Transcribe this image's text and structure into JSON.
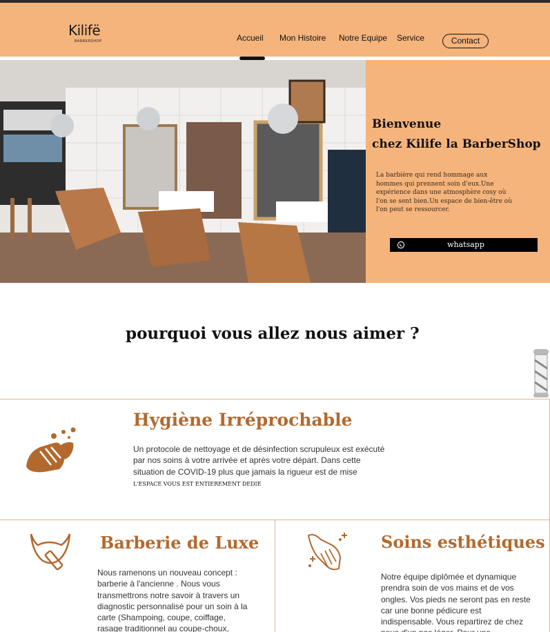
{
  "header": {
    "logo_text": "Kilifë",
    "logo_subtitle": "BARBERSHOP",
    "nav": {
      "home": "Accueil",
      "story": "Mon Histoire",
      "team": "Notre Equipe",
      "service": "Service",
      "contact": "Contact"
    }
  },
  "hero": {
    "title_line1": "Bienvenue",
    "title_line2": "chez Kilife la BarberShop",
    "description": "La barbière qui rend hommage aux hommes qui prennent soin d'eux.Une expérience dans une atmosphère cosy où l'on se sent bien.Un espace de bien-être où l'on peut se ressourcer.",
    "whatsapp_label": "whatsapp",
    "image_desc": "barbershop-interior-photo"
  },
  "why": {
    "title": "pourquoi vous allez nous aimer ?"
  },
  "features": {
    "hygiene": {
      "title": "Hygiène Irréprochable",
      "text": "Un protocole de nettoyage et de désinfection scrupuleux est exécuté par nos soins à votre arrivée et après votre départ. Dans cette situation de COVID-19 plus que jamais la rigueur est de mise",
      "small": "L'ESPACE VOUS EST ENTIEREMENT DEDIE"
    },
    "luxury": {
      "title": "Barberie de Luxe",
      "text": "Nous ramenons un nouveau concept : barberie à l'ancienne . Nous vous transmettrons notre savoir à travers un diagnostic personnalisé pour un soin à la carte (Shampoing, coupe, coiffage, rasage traditionnel au coupe-choux,"
    },
    "care": {
      "title": "Soins esthétiques",
      "text": "Notre équipe diplômée et dynamique prendra soin de vos mains et de vos ongles. Vos pieds ne seront pas en reste car une bonne pédicure est indispensable. Vous repartirez de chez nous d'un pas léger. Pour une"
    }
  },
  "colors": {
    "accent": "#f5b47c",
    "brand_brown": "#b3692e",
    "border": "#e2b48a",
    "dark": "#111111"
  }
}
